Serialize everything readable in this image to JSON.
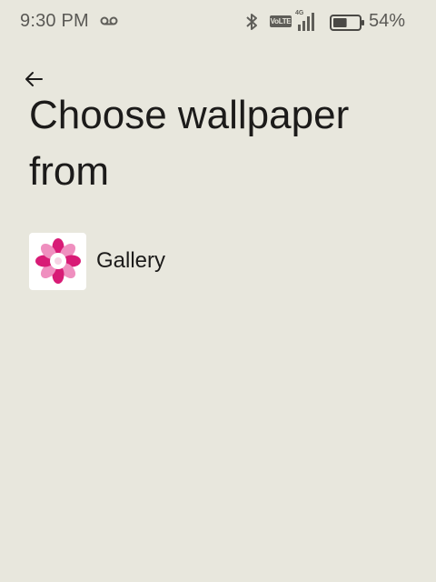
{
  "status_bar": {
    "time": "9:30 PM",
    "network_type": "4G",
    "volte_label": "VoLTE",
    "battery_percent": "54%",
    "battery_level": 0.54,
    "icons": [
      "voicemail-icon",
      "bluetooth-icon",
      "volte-icon",
      "signal-icon",
      "battery-icon"
    ]
  },
  "header": {
    "back_icon": "arrow-left-icon",
    "title": "Choose wallpaper from"
  },
  "options": [
    {
      "label": "Gallery",
      "icon": "gallery-flower-icon"
    }
  ],
  "colors": {
    "background": "#e8e7dd",
    "text": "#1c1b1a",
    "status_text": "#5a5955",
    "flower_dark_pink": "#d81b76",
    "flower_light_pink": "#ef8fbf"
  }
}
